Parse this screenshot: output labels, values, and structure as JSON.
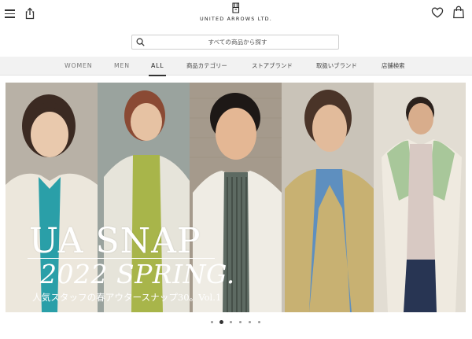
{
  "header": {
    "brand": "UNITED ARROWS LTD.",
    "menu_icon": "hamburger-menu-icon",
    "share_icon": "share-icon",
    "favorite_icon": "heart-icon",
    "cart_icon": "shopping-bag-icon"
  },
  "search": {
    "placeholder": "すべての商品から探す",
    "icon": "search-icon"
  },
  "nav": {
    "items": [
      {
        "label": "WOMEN",
        "active": false
      },
      {
        "label": "MEN",
        "active": false
      },
      {
        "label": "ALL",
        "active": true
      },
      {
        "label": "商品カテゴリー",
        "active": false
      },
      {
        "label": "ストアブランド",
        "active": false
      },
      {
        "label": "取扱いブランド",
        "active": false
      },
      {
        "label": "店舗検索",
        "active": false
      }
    ]
  },
  "hero": {
    "title": "UA SNAP",
    "subtitle": "2022 SPRING.",
    "caption": "人気スタッフの春アウタースナップ30。Vol.1"
  },
  "carousel": {
    "slide_count": 6,
    "active_index": 1
  },
  "colors": {
    "nav_background": "#f2f2f2",
    "text": "#222222",
    "active_underline": "#333333",
    "hero_text": "#ffffff"
  }
}
